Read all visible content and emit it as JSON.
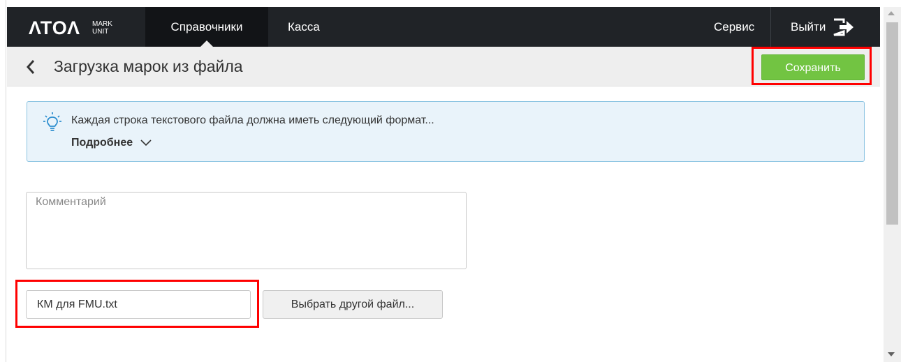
{
  "nav": {
    "logo_text": "ATOL",
    "logo_sub_line1": "MARK",
    "logo_sub_line2": "UNIT",
    "items": [
      {
        "label": "Справочники"
      },
      {
        "label": "Касса"
      }
    ],
    "service_label": "Сервис",
    "logout_label": "Выйти"
  },
  "toolbar": {
    "title": "Загрузка марок из файла",
    "save_label": "Сохранить"
  },
  "info": {
    "text": "Каждая строка текстового файла должна иметь следующий формат...",
    "more_label": "Подробнее"
  },
  "form": {
    "comment_placeholder": "Комментарий",
    "file_name": "КМ для FMU.txt",
    "choose_file_label": "Выбрать другой файл..."
  },
  "colors": {
    "navbar_bg": "#202327",
    "save_button": "#72c442",
    "info_bg": "#e9f3fa",
    "info_border": "#8cc4e2",
    "highlight": "#ff0000"
  },
  "icons": [
    "chevron-left-icon",
    "lightbulb-icon",
    "chevron-down-icon",
    "logout-icon"
  ]
}
